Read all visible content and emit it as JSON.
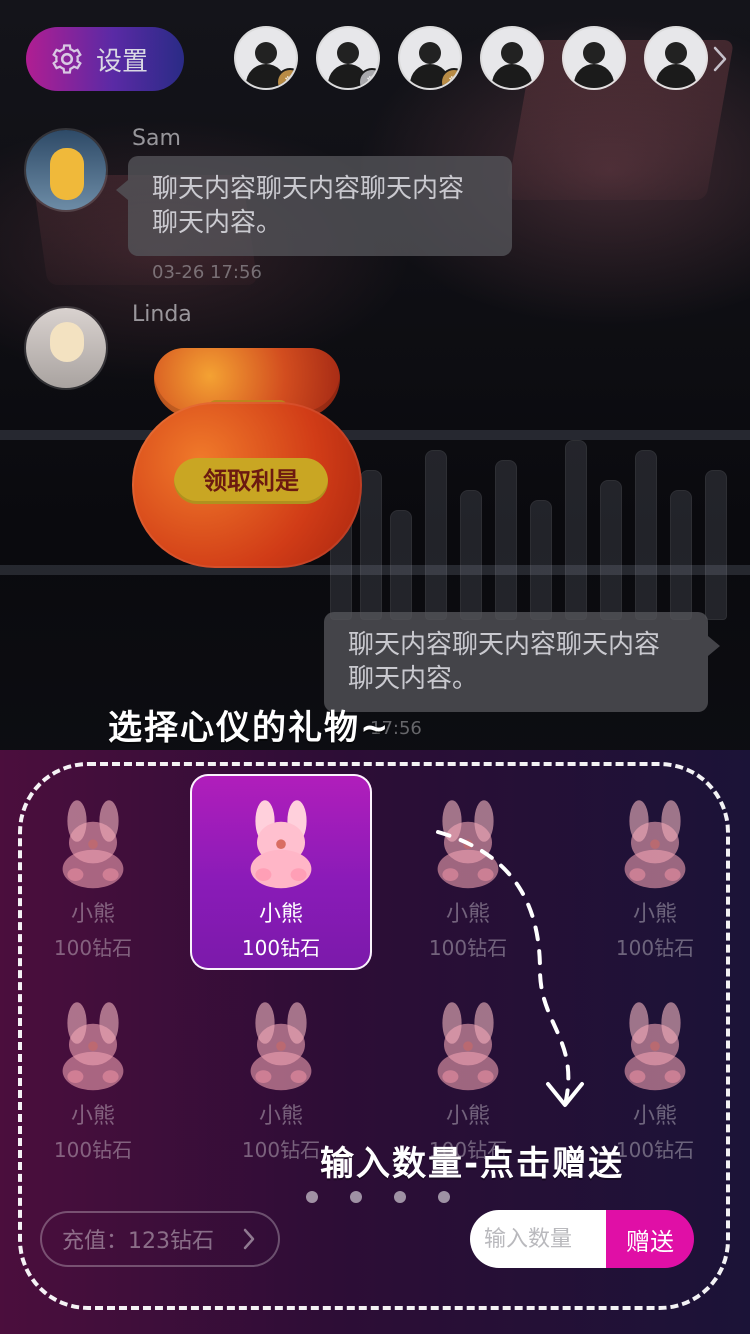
{
  "top_bar": {
    "settings_label": "设置",
    "viewers": [
      {
        "badge": "crown",
        "badge_tone": "gold"
      },
      {
        "badge": "crown",
        "badge_tone": "silver"
      },
      {
        "badge": "crown",
        "badge_tone": "gold"
      },
      {
        "badge": null
      },
      {
        "badge": null
      },
      {
        "badge": null
      }
    ],
    "more_icon": "chevron-right-icon"
  },
  "chat": {
    "messages": [
      {
        "user": "Sam",
        "text_line1": "聊天内容聊天内容聊天内容",
        "text_line2": "聊天内容。",
        "time": "03-26 17:56"
      },
      {
        "user": "Linda",
        "red_packet_button": "领取利是"
      },
      {
        "text_line1": "聊天内容聊天内容聊天内容",
        "text_line2": "聊天内容。",
        "time": "17:56"
      }
    ]
  },
  "annotations": {
    "top_hint": "选择心仪的礼物~",
    "bottom_hint": "输入数量-点击赠送"
  },
  "gift_panel": {
    "gifts": [
      {
        "name": "小熊",
        "price": "100钻石",
        "selected": false
      },
      {
        "name": "小熊",
        "price": "100钻石",
        "selected": true
      },
      {
        "name": "小熊",
        "price": "100钻石",
        "selected": false
      },
      {
        "name": "小熊",
        "price": "100钻石",
        "selected": false
      },
      {
        "name": "小熊",
        "price": "100钻石",
        "selected": false
      },
      {
        "name": "小熊",
        "price": "100钻石",
        "selected": false
      },
      {
        "name": "小熊",
        "price": "100钻石",
        "selected": false
      },
      {
        "name": "小熊",
        "price": "100钻石",
        "selected": false
      }
    ],
    "page_dots": 4,
    "recharge_label": "充值：123钻石",
    "quantity_placeholder": "输入数量",
    "send_label": "赠送",
    "colors": {
      "selected_gradient_start": "#b11ebb",
      "selected_gradient_end": "#7b1aaa",
      "send_button": "#e00fa6",
      "panel_left": "#4b0e3d",
      "panel_right": "#1b1337"
    }
  }
}
